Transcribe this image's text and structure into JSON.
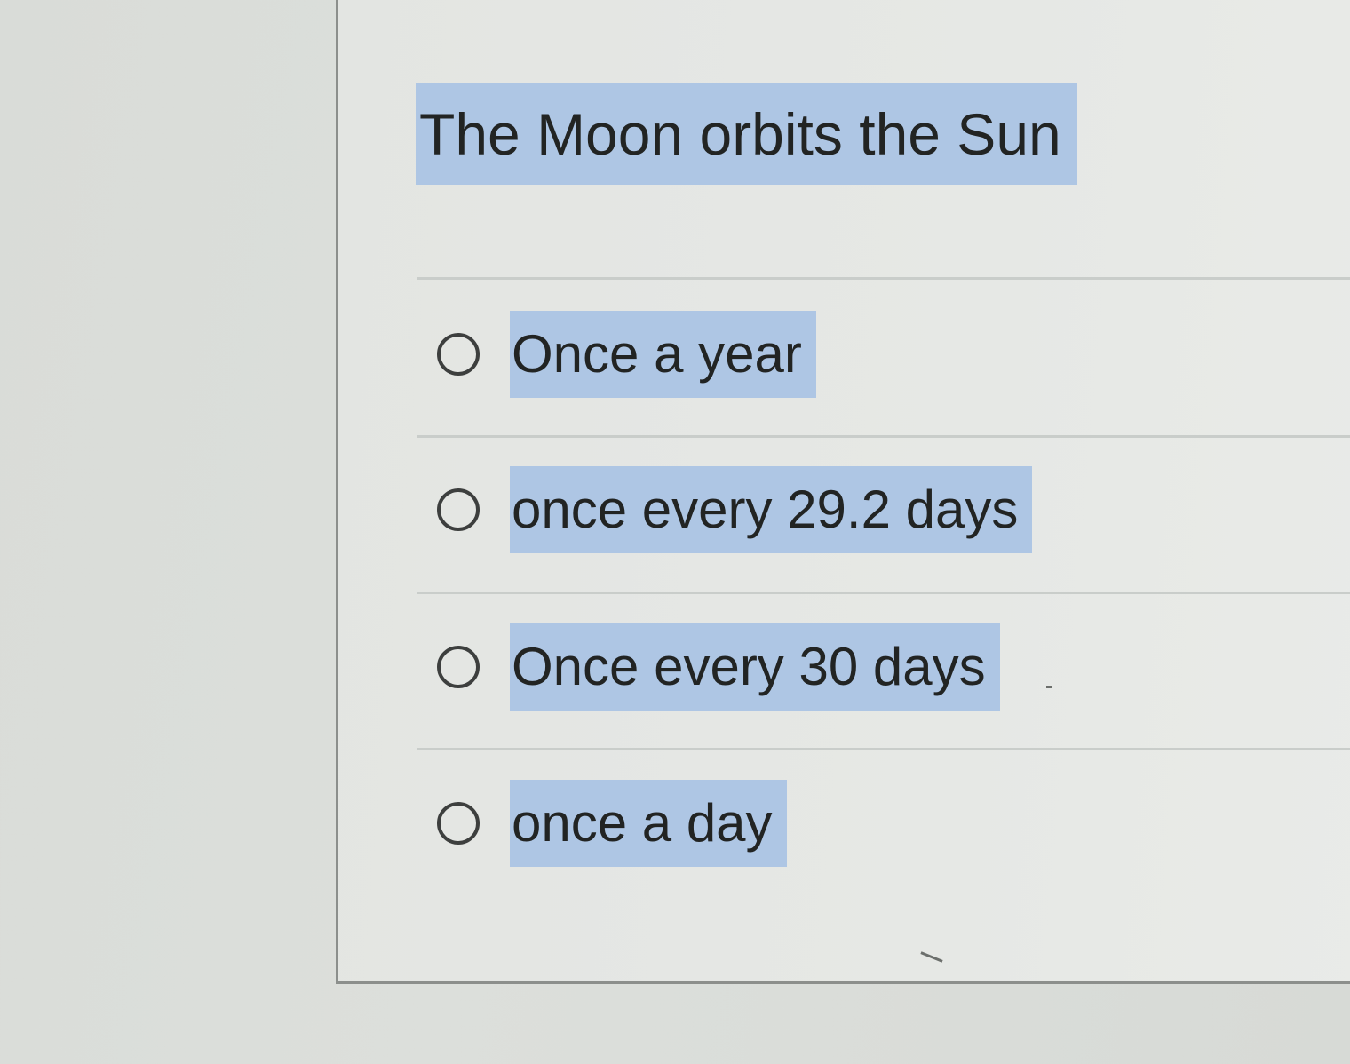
{
  "question": {
    "text": "The Moon orbits the Sun"
  },
  "answers": [
    {
      "label": "Once a year",
      "selected": false
    },
    {
      "label": "once every 29.2 days",
      "selected": false
    },
    {
      "label": "Once every 30 days",
      "selected": false
    },
    {
      "label": "once a day",
      "selected": false
    }
  ],
  "colors": {
    "highlight": "#aec6e4",
    "text": "#222423",
    "card_background": "#e5e7e4",
    "radio_border": "#3d3f3e"
  }
}
